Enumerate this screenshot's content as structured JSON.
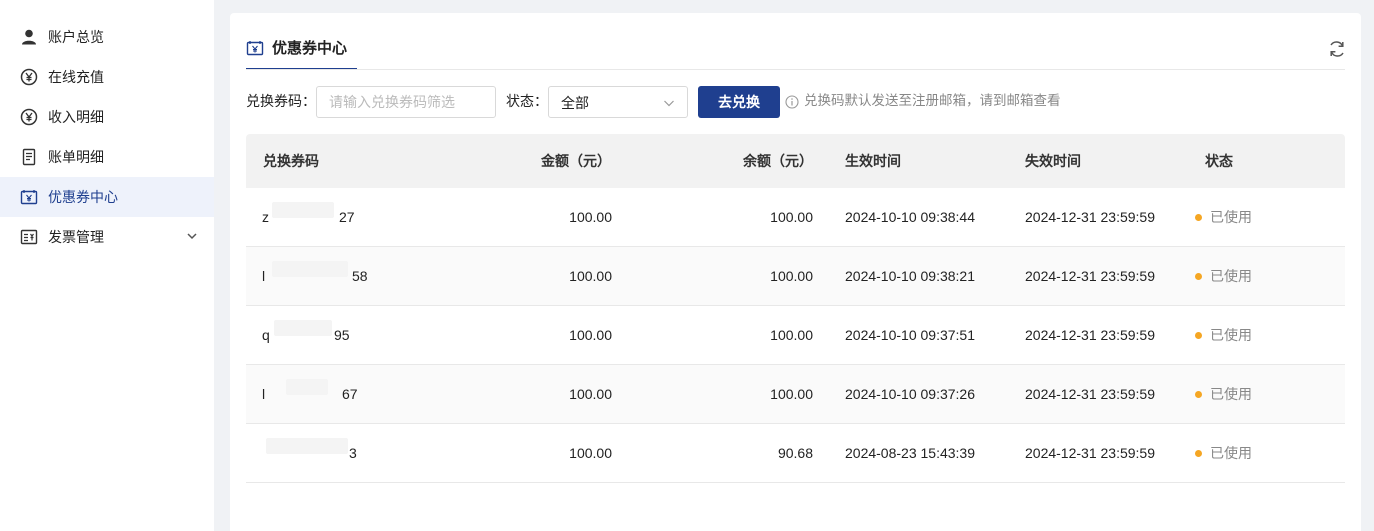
{
  "sidebar": {
    "items": [
      {
        "label": "账户总览",
        "icon": "user-icon"
      },
      {
        "label": "在线充值",
        "icon": "yen-circle-icon"
      },
      {
        "label": "收入明细",
        "icon": "yen-circle-icon"
      },
      {
        "label": "账单明细",
        "icon": "receipt-icon"
      },
      {
        "label": "优惠券中心",
        "icon": "coupon-icon",
        "active": true
      },
      {
        "label": "发票管理",
        "icon": "invoice-icon",
        "expandable": true
      }
    ]
  },
  "main": {
    "tab_label": "优惠券中心",
    "filter": {
      "code_label": "兑换券码：",
      "code_placeholder": "请输入兑换券码筛选",
      "status_label": "状态：",
      "status_value": "全部",
      "redeem_button": "去兑换",
      "hint": "兑换码默认发送至注册邮箱，请到邮箱查看"
    },
    "table": {
      "headers": [
        "兑换券码",
        "金额（元）",
        "余额（元）",
        "生效时间",
        "失效时间",
        "状态"
      ],
      "rows": [
        {
          "code_prefix": "z",
          "code_suffix": "27",
          "amount": "100.00",
          "balance": "100.00",
          "start": "2024-10-10 09:38:44",
          "end": "2024-12-31 23:59:59",
          "status": "已使用"
        },
        {
          "code_prefix": "l",
          "code_suffix": "58",
          "amount": "100.00",
          "balance": "100.00",
          "start": "2024-10-10 09:38:21",
          "end": "2024-12-31 23:59:59",
          "status": "已使用"
        },
        {
          "code_prefix": "q",
          "code_suffix": "95",
          "amount": "100.00",
          "balance": "100.00",
          "start": "2024-10-10 09:37:51",
          "end": "2024-12-31 23:59:59",
          "status": "已使用"
        },
        {
          "code_prefix": "l",
          "code_suffix": "67",
          "amount": "100.00",
          "balance": "100.00",
          "start": "2024-10-10 09:37:26",
          "end": "2024-12-31 23:59:59",
          "status": "已使用"
        },
        {
          "code_prefix": "",
          "code_suffix": "3",
          "amount": "100.00",
          "balance": "90.68",
          "start": "2024-08-23 15:43:39",
          "end": "2024-12-31 23:59:59",
          "status": "已使用"
        }
      ]
    }
  },
  "colors": {
    "accent": "#1f3f8f",
    "status_used_dot": "#f5a623",
    "sidebar_active_bg": "#eef2fb",
    "table_header_bg": "#f2f2f2"
  }
}
